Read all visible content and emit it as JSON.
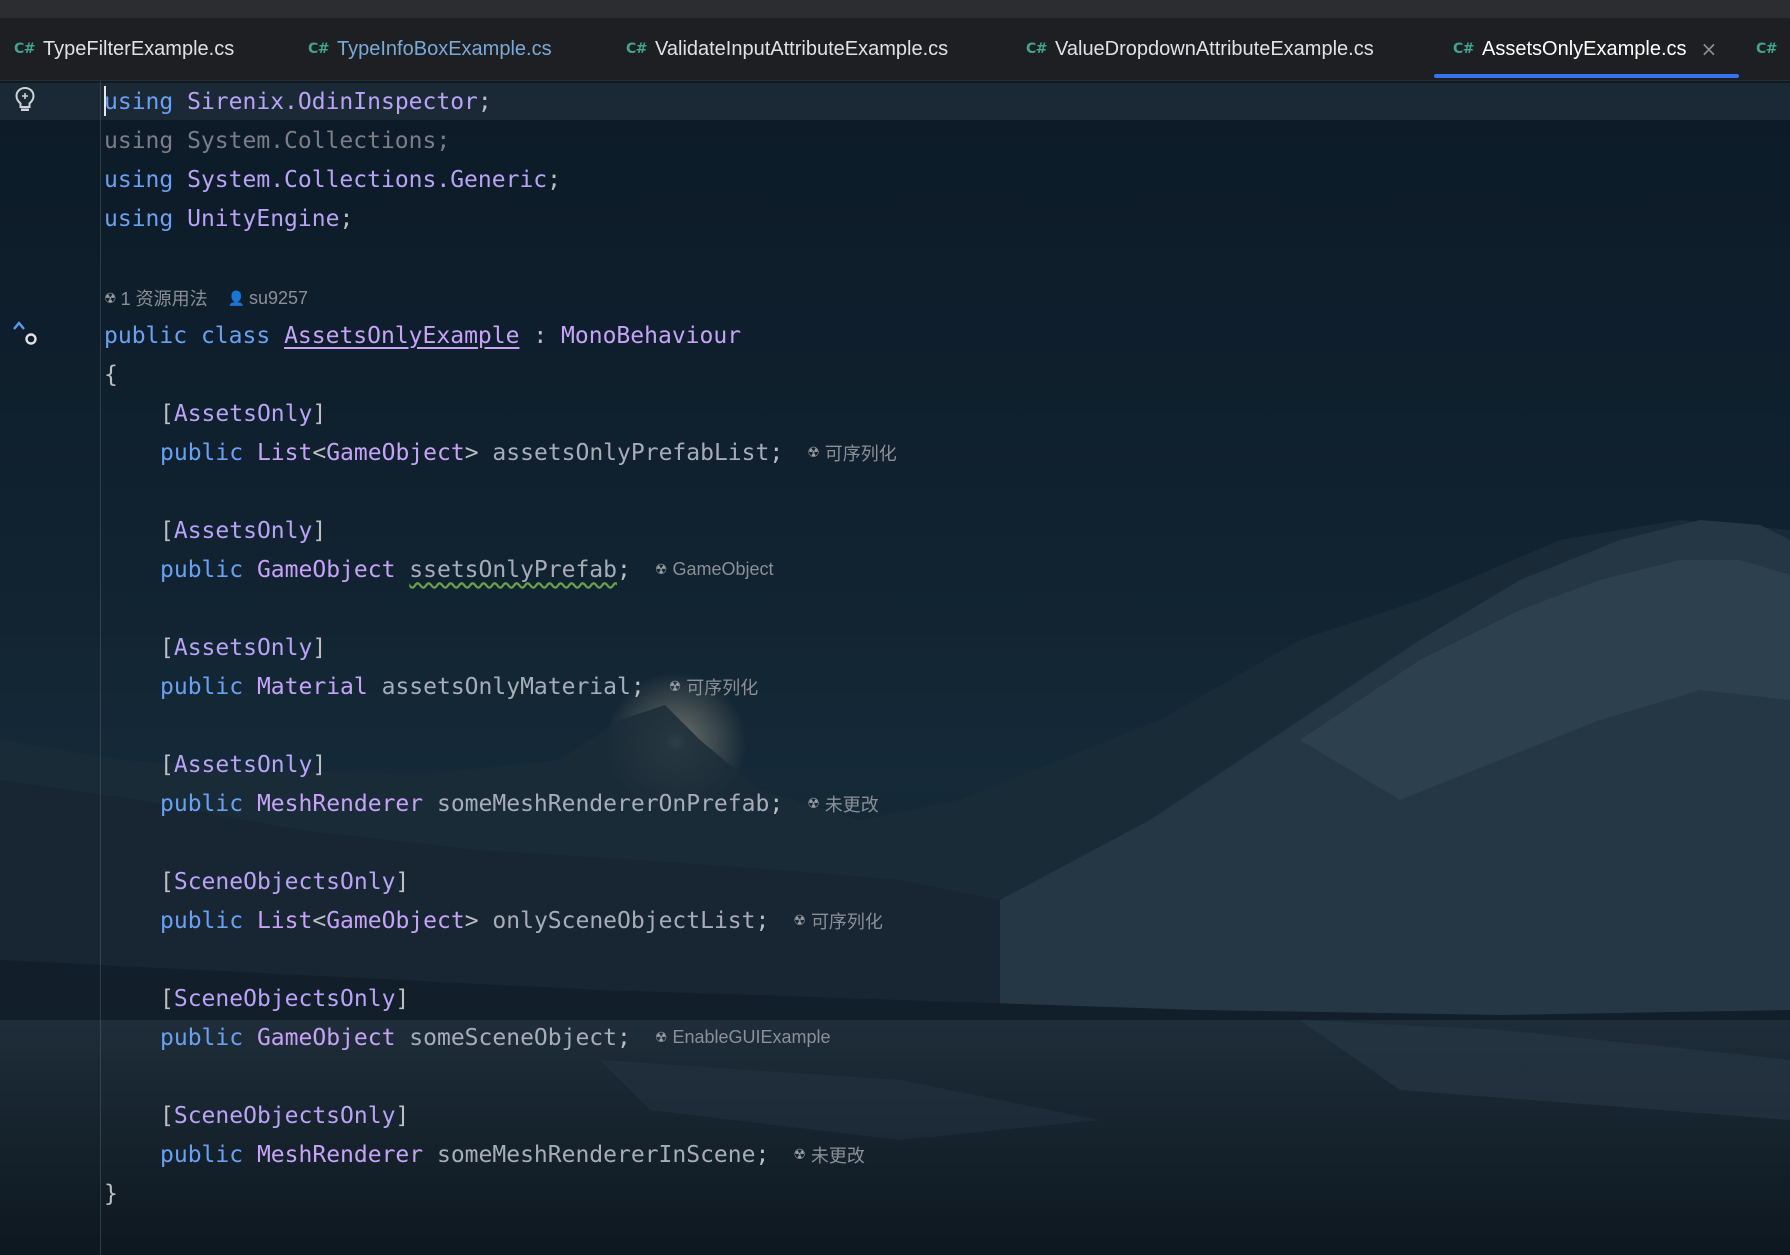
{
  "tabs": [
    {
      "badge": "C#",
      "label": "TypeFilterExample.cs",
      "state": "normal"
    },
    {
      "badge": "C#",
      "label": "TypeInfoBoxExample.cs",
      "state": "linked"
    },
    {
      "badge": "C#",
      "label": "ValidateInputAttributeExample.cs",
      "state": "normal"
    },
    {
      "badge": "C#",
      "label": "ValueDropdownAttributeExample.cs",
      "state": "normal"
    },
    {
      "badge": "C#",
      "label": "AssetsOnlyExample.cs",
      "state": "active",
      "close": "×"
    },
    {
      "badge": "C#",
      "label": "",
      "state": "normal"
    }
  ],
  "hint": {
    "usages": "1 资源用法",
    "author": "su9257"
  },
  "code": {
    "l1": {
      "kw": "using",
      "ns": "Sirenix.OdinInspector",
      "end": ";"
    },
    "l2": {
      "text": "using System.Collections;"
    },
    "l3": {
      "kw": "using",
      "ns": "System.Collections.Generic",
      "end": ";"
    },
    "l4": {
      "kw": "using",
      "ns": "UnityEngine",
      "end": ";"
    },
    "class_decl": {
      "kw1": "public",
      "kw2": "class",
      "name": "AssetsOnlyExample",
      "colon": ":",
      "base": "MonoBehaviour"
    },
    "open_brace": "{",
    "close_brace": "}",
    "members": [
      {
        "attr": "AssetsOnly",
        "kw": "public",
        "type": "List",
        "generic": "GameObject",
        "field": "assetsOnlyPrefabList",
        "inlay": "可序列化"
      },
      {
        "attr": "AssetsOnly",
        "kw": "public",
        "type": "GameObject",
        "generic": "",
        "field": "ssetsOnlyPrefab",
        "inlay": "GameObject"
      },
      {
        "attr": "AssetsOnly",
        "kw": "public",
        "type": "Material",
        "generic": "",
        "field": "assetsOnlyMaterial",
        "inlay": "可序列化"
      },
      {
        "attr": "AssetsOnly",
        "kw": "public",
        "type": "MeshRenderer",
        "generic": "",
        "field": "someMeshRendererOnPrefab",
        "inlay": "未更改"
      },
      {
        "attr": "SceneObjectsOnly",
        "kw": "public",
        "type": "List",
        "generic": "GameObject",
        "field": "onlySceneObjectList",
        "inlay": "可序列化"
      },
      {
        "attr": "SceneObjectsOnly",
        "kw": "public",
        "type": "GameObject",
        "generic": "",
        "field": "someSceneObject",
        "inlay": "EnableGUIExample"
      },
      {
        "attr": "SceneObjectsOnly",
        "kw": "public",
        "type": "MeshRenderer",
        "generic": "",
        "field": "someMeshRendererInScene",
        "inlay": "未更改"
      }
    ]
  },
  "colors": {
    "keyword": "#6aa0f2",
    "type": "#c7a3f8",
    "field": "#a7adb8",
    "tab_accent": "#3574f0",
    "cs_badge": "#3fa58e"
  },
  "icons": {
    "gutter_top": "lightbulb-icon",
    "gutter_class": "implemented-up-icon",
    "inlay": "unity-icon",
    "author": "user-icon",
    "tab_close": "close-icon"
  }
}
